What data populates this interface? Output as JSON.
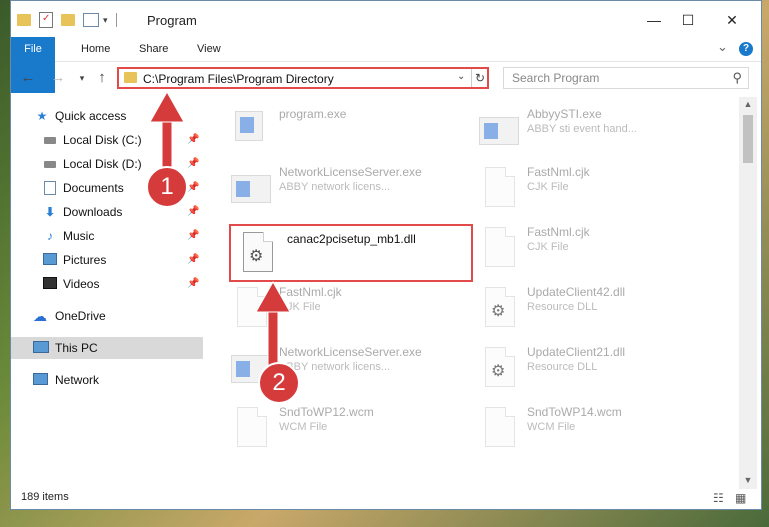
{
  "window": {
    "title": "Program",
    "minimize": "—",
    "maximize": "☐",
    "close": "✕"
  },
  "ribbon": {
    "tabs": [
      "File",
      "Home",
      "Share",
      "View"
    ],
    "expand": "⌄",
    "help": "?"
  },
  "address": {
    "path": "C:\\Program Files\\Program Directory",
    "search_placeholder": "Search Program"
  },
  "sidebar": {
    "items": [
      {
        "label": "Quick access",
        "icon": "star-icon",
        "pinned": false
      },
      {
        "label": "Local Disk (C:)",
        "icon": "drive-icon",
        "pinned": true
      },
      {
        "label": "Local Disk (D:)",
        "icon": "drive-icon",
        "pinned": true
      },
      {
        "label": "Documents",
        "icon": "documents-icon",
        "pinned": true
      },
      {
        "label": "Downloads",
        "icon": "download-icon",
        "pinned": true
      },
      {
        "label": "Music",
        "icon": "music-icon",
        "pinned": true
      },
      {
        "label": "Pictures",
        "icon": "pictures-icon",
        "pinned": true
      },
      {
        "label": "Videos",
        "icon": "videos-icon",
        "pinned": true
      },
      {
        "label": "OneDrive",
        "icon": "cloud-icon",
        "pinned": false
      },
      {
        "label": "This PC",
        "icon": "computer-icon",
        "pinned": false
      },
      {
        "label": "Network",
        "icon": "network-icon",
        "pinned": false
      }
    ]
  },
  "files": [
    {
      "name": "program.exe",
      "type": "",
      "kind": "exe"
    },
    {
      "name": "AbbyySTI.exe",
      "type": "ABBY sti event hand...",
      "kind": "exe"
    },
    {
      "name": "NetworkLicenseServer.exe",
      "type": "ABBY network licens...",
      "kind": "exe"
    },
    {
      "name": "FastNml.cjk",
      "type": "CJK File",
      "kind": "doc"
    },
    {
      "name": "canac2pcisetup_mb1.dll",
      "type": "",
      "kind": "dll"
    },
    {
      "name": "FastNml.cjk",
      "type": "CJK File",
      "kind": "doc"
    },
    {
      "name": "FastNml.cjk",
      "type": "CJK File",
      "kind": "doc"
    },
    {
      "name": "UpdateClient42.dll",
      "type": "Resource DLL",
      "kind": "dll"
    },
    {
      "name": "NetworkLicenseServer.exe",
      "type": "ABBY network licens...",
      "kind": "exe"
    },
    {
      "name": "UpdateClient21.dll",
      "type": "Resource DLL",
      "kind": "dll"
    },
    {
      "name": "SndToWP12.wcm",
      "type": "WCM File",
      "kind": "doc"
    },
    {
      "name": "SndToWP14.wcm",
      "type": "WCM File",
      "kind": "doc"
    }
  ],
  "status": {
    "count": "189 items"
  },
  "callouts": {
    "one": "1",
    "two": "2"
  },
  "colors": {
    "accent": "#1979ca",
    "highlight": "#e34a4a",
    "callout": "#d63b3b"
  }
}
